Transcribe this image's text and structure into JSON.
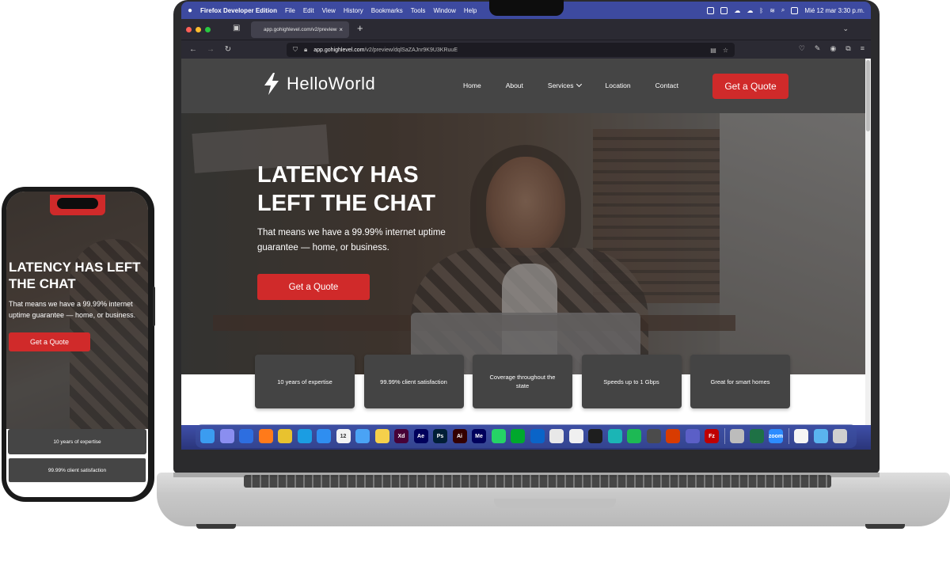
{
  "menubar": {
    "apple": "",
    "app_name": "Firefox Developer Edition",
    "items": [
      "File",
      "Edit",
      "View",
      "History",
      "Bookmarks",
      "Tools",
      "Window",
      "Help"
    ],
    "date_time": "Mié 12 mar  3:30 p.m."
  },
  "browser": {
    "tab_title": "app.gohighlevel.com/v2/preview",
    "url_domain": "app.gohighlevel.com",
    "url_path": "/v2/preview/dqlSaZAJnr9K9U3KRuuE"
  },
  "site": {
    "logo_text": "HelloWorld",
    "nav": {
      "home": "Home",
      "about": "About",
      "services": "Services",
      "location": "Location",
      "contact": "Contact"
    },
    "header_cta": "Get a Quote",
    "hero": {
      "title": "LATENCY HAS LEFT THE CHAT",
      "subtitle": "That means we have a 99.99% internet uptime guarantee — home, or business.",
      "cta": "Get a Quote"
    },
    "features": [
      {
        "text": "10 years of expertise"
      },
      {
        "text": "99.99% client satisfaction"
      },
      {
        "text": "Coverage throughout the state"
      },
      {
        "text": "Speeds up to 1 Gbps"
      },
      {
        "text": "Great for smart homes"
      }
    ]
  },
  "dock": {
    "apps": [
      {
        "name": "finder-icon",
        "label": "",
        "color": "#3b9cf0"
      },
      {
        "name": "launchpad-icon",
        "label": "",
        "color": "#8a8ef0"
      },
      {
        "name": "firefox-dev-icon",
        "label": "",
        "color": "#2d6ee0"
      },
      {
        "name": "firefox-icon",
        "label": "",
        "color": "#ff7a1a"
      },
      {
        "name": "chrome-icon",
        "label": "",
        "color": "#e8c22f"
      },
      {
        "name": "edge-icon",
        "label": "",
        "color": "#1b9de2"
      },
      {
        "name": "safari-icon",
        "label": "",
        "color": "#2f8ef0"
      },
      {
        "name": "calendar-icon",
        "label": "12",
        "color": "#f2f2f2"
      },
      {
        "name": "weather-icon",
        "label": "",
        "color": "#4aa3f5"
      },
      {
        "name": "notes-icon",
        "label": "",
        "color": "#f5d04b"
      },
      {
        "name": "xd-icon",
        "label": "Xd",
        "color": "#470137"
      },
      {
        "name": "ae-icon",
        "label": "Ae",
        "color": "#00005b"
      },
      {
        "name": "ps-icon",
        "label": "Ps",
        "color": "#001e36"
      },
      {
        "name": "ai-icon",
        "label": "Ai",
        "color": "#330000"
      },
      {
        "name": "me-icon",
        "label": "Me",
        "color": "#00005b"
      },
      {
        "name": "whatsapp-icon",
        "label": "",
        "color": "#25d366"
      },
      {
        "name": "evernote-icon",
        "label": "",
        "color": "#00a82d"
      },
      {
        "name": "outlook-icon",
        "label": "",
        "color": "#0a64c8"
      },
      {
        "name": "slack-icon",
        "label": "",
        "color": "#e8e8e8"
      },
      {
        "name": "craft-icon",
        "label": "",
        "color": "#f0f0f0"
      },
      {
        "name": "figma-icon",
        "label": "",
        "color": "#1e1e1e"
      },
      {
        "name": "surfshark-icon",
        "label": "",
        "color": "#1bb5b5"
      },
      {
        "name": "spotify-icon",
        "label": "",
        "color": "#1db954"
      },
      {
        "name": "sublime-icon",
        "label": "",
        "color": "#4b4b4b"
      },
      {
        "name": "ms-office-icon",
        "label": "",
        "color": "#d83b01"
      },
      {
        "name": "teams-icon",
        "label": "",
        "color": "#5b5fc7"
      },
      {
        "name": "filezilla-icon",
        "label": "Fz",
        "color": "#bf0000"
      },
      {
        "name": "font-book-icon",
        "label": "",
        "color": "#bcbcbc"
      },
      {
        "name": "excel-icon",
        "label": "",
        "color": "#1e7145"
      },
      {
        "name": "zoom-icon",
        "label": "zoom",
        "color": "#2d8cff"
      },
      {
        "name": "google-icon",
        "label": "",
        "color": "#f5f5f5"
      },
      {
        "name": "folder-icon",
        "label": "",
        "color": "#5ab4ef"
      },
      {
        "name": "trash-icon",
        "label": "",
        "color": "#cfcfcf"
      }
    ]
  },
  "phone": {
    "hero_title": "LATENCY HAS LEFT THE CHAT",
    "hero_subtitle": "That means we have a 99.99% internet uptime guarantee — home, or business.",
    "cta": "Get a Quote",
    "features": [
      {
        "text": "10 years of expertise"
      },
      {
        "text": "99.99% client satisfaction"
      }
    ]
  }
}
